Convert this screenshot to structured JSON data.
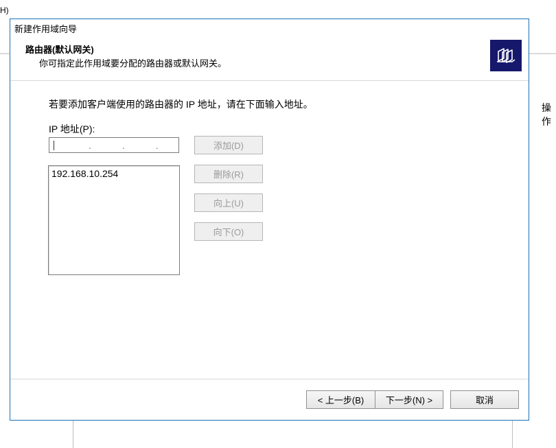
{
  "bg": {
    "menu_h": "H)",
    "side_text": "操作"
  },
  "wizard": {
    "title": "新建作用域向导",
    "heading": "路由器(默认网关)",
    "subheading": "你可指定此作用域要分配的路由器或默认网关。",
    "hint": "若要添加客户端使用的路由器的 IP 地址，请在下面输入地址。",
    "ip_label": "IP 地址(P):",
    "entries": [
      "192.168.10.254"
    ],
    "buttons": {
      "add": "添加(D)",
      "remove": "删除(R)",
      "up": "向上(U)",
      "down": "向下(O)",
      "back": "< 上一步(B)",
      "next": "下一步(N) >",
      "cancel": "取消"
    }
  }
}
